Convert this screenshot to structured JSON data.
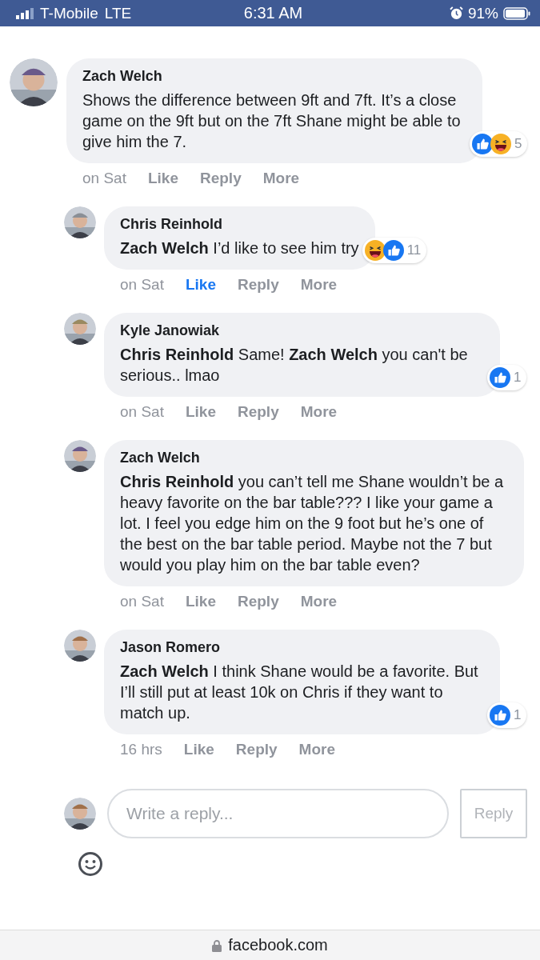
{
  "status_bar": {
    "carrier": "T-Mobile",
    "network": "LTE",
    "time": "6:31 AM",
    "battery": "91%"
  },
  "comments": [
    {
      "kind": "comment",
      "author": "Zach Welch",
      "text": "Shows the difference between 9ft and 7ft. It’s a close game on the 9ft but on the 7ft Shane might be able to give him the 7.",
      "reactions": [
        {
          "kind": "like"
        },
        {
          "kind": "haha"
        }
      ],
      "reaction_count": "5",
      "time": "on Sat",
      "actions": [
        {
          "label": "Like",
          "selected": false
        },
        {
          "label": "Reply",
          "selected": false
        },
        {
          "label": "More",
          "selected": false
        }
      ]
    },
    {
      "kind": "reply",
      "author": "Chris Reinhold",
      "text": "**Zach Welch** I’d like to see him try",
      "reactions": [
        {
          "kind": "haha"
        },
        {
          "kind": "like"
        }
      ],
      "reaction_count": "11",
      "time": "on Sat",
      "actions": [
        {
          "label": "Like",
          "selected": true
        },
        {
          "label": "Reply",
          "selected": false
        },
        {
          "label": "More",
          "selected": false
        }
      ]
    },
    {
      "kind": "reply",
      "author": "Kyle Janowiak",
      "text": "**Chris Reinhold** Same! **Zach Welch** you can't be serious.. lmao",
      "reactions": [
        {
          "kind": "like"
        }
      ],
      "reaction_count": "1",
      "time": "on Sat",
      "actions": [
        {
          "label": "Like",
          "selected": false
        },
        {
          "label": "Reply",
          "selected": false
        },
        {
          "label": "More",
          "selected": false
        }
      ]
    },
    {
      "kind": "reply",
      "author": "Zach Welch",
      "text": "**Chris Reinhold** you can’t tell me Shane wouldn’t be a heavy favorite on the bar table??? I like your game a lot. I feel you edge him on the 9 foot but he’s one of the best on the bar table period. Maybe not the 7 but would you play him on the bar table even?",
      "time": "on Sat",
      "actions": [
        {
          "label": "Like",
          "selected": false
        },
        {
          "label": "Reply",
          "selected": false
        },
        {
          "label": "More",
          "selected": false
        }
      ]
    },
    {
      "kind": "reply",
      "author": "Jason Romero",
      "text": "**Zach Welch** I think Shane would be a favorite. But I’ll still put at least 10k on Chris if they want to match up.",
      "reactions": [
        {
          "kind": "like"
        }
      ],
      "reaction_count": "1",
      "time": "16 hrs",
      "actions": [
        {
          "label": "Like",
          "selected": false
        },
        {
          "label": "Reply",
          "selected": false
        },
        {
          "label": "More",
          "selected": false
        }
      ]
    }
  ],
  "reply_box": {
    "placeholder": "Write a reply...",
    "button": "Reply"
  },
  "address_bar": {
    "url": "facebook.com"
  }
}
